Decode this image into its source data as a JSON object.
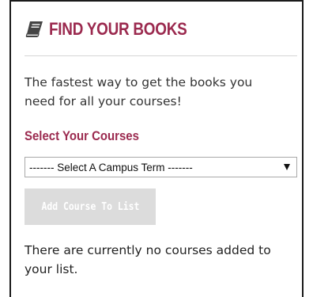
{
  "panel": {
    "title": "FIND YOUR BOOKS",
    "title_icon": "book-icon",
    "intro": "The fastest way to get the books you need for all your courses!",
    "select_label": "Select Your Courses",
    "select": {
      "selected": "------- Select A Campus Term -------"
    },
    "add_button_label": "Add Course To List",
    "empty_message": "There are currently no courses added to your list."
  },
  "colors": {
    "accent": "#9b2a4f",
    "button_disabled_bg": "#dcdcdc"
  }
}
